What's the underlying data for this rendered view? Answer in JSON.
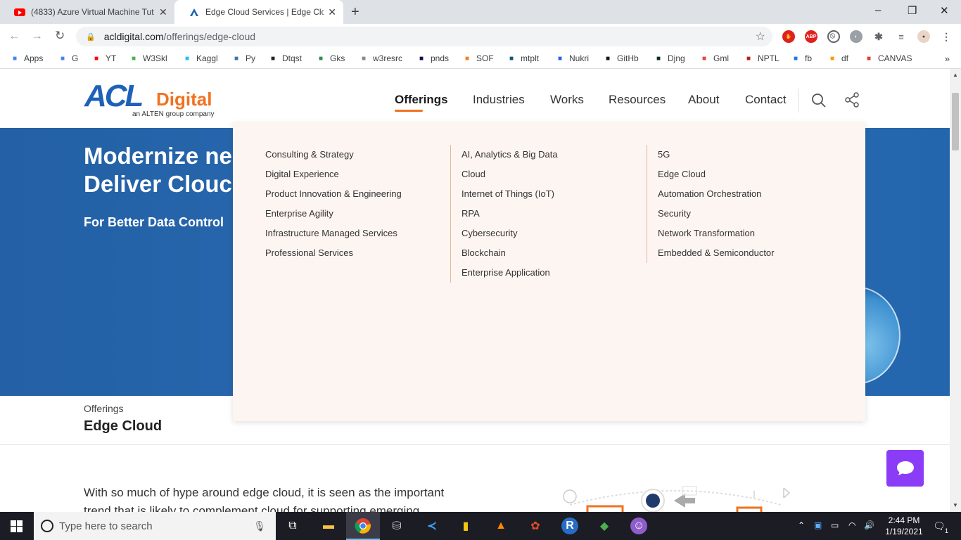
{
  "browser": {
    "tabs": [
      {
        "title": "(4833) Azure Virtual Machine Tut",
        "active": false,
        "favicon": "youtube-icon"
      },
      {
        "title": "Edge Cloud Services | Edge Clouc",
        "active": true,
        "favicon": "acl-digital-icon"
      }
    ],
    "new_tab_glyph": "+",
    "window_controls": [
      "–",
      "❐",
      "✕"
    ],
    "url_host": "acldigital.com",
    "url_path": "/offerings/edge-cloud",
    "bookmarks": [
      {
        "label": "Apps",
        "icon": "apps-grid-icon",
        "color": "#4285f4"
      },
      {
        "label": "G",
        "icon": "google-icon",
        "color": "#4285f4"
      },
      {
        "label": "YT",
        "icon": "youtube-icon",
        "color": "#ff0000"
      },
      {
        "label": "W3Skl",
        "icon": "w3schools-icon",
        "color": "#4caf50"
      },
      {
        "label": "Kaggl",
        "icon": "kaggle-icon",
        "color": "#20beff"
      },
      {
        "label": "Py",
        "icon": "python-icon",
        "color": "#3776ab"
      },
      {
        "label": "Dtqst",
        "icon": "dataquest-icon",
        "color": "#222222"
      },
      {
        "label": "Gks",
        "icon": "geeksforgeeks-icon",
        "color": "#2f8d46"
      },
      {
        "label": "w3resrc",
        "icon": "w3resource-icon",
        "color": "#888888"
      },
      {
        "label": "pnds",
        "icon": "pandas-icon",
        "color": "#150458"
      },
      {
        "label": "SOF",
        "icon": "stackoverflow-icon",
        "color": "#f48024"
      },
      {
        "label": "mtplt",
        "icon": "matplotlib-icon",
        "color": "#11557c"
      },
      {
        "label": "Nukri",
        "icon": "naukri-icon",
        "color": "#275df5"
      },
      {
        "label": "GitHb",
        "icon": "github-icon",
        "color": "#181717"
      },
      {
        "label": "Djng",
        "icon": "django-icon",
        "color": "#092e20"
      },
      {
        "label": "Gml",
        "icon": "gmail-icon",
        "color": "#ea4335"
      },
      {
        "label": "NPTL",
        "icon": "nptel-icon",
        "color": "#b22222"
      },
      {
        "label": "fb",
        "icon": "facebook-icon",
        "color": "#1877f2"
      },
      {
        "label": "df",
        "icon": "dialogflow-icon",
        "color": "#ff9800"
      },
      {
        "label": "CANVAS",
        "icon": "canvas-icon",
        "color": "#e13f2b"
      }
    ],
    "bookmarks_more": "»"
  },
  "site": {
    "logo_main": "ACL",
    "logo_sub": "Digital",
    "logo_tagline": "an ALTEN group company",
    "nav": [
      "Offerings",
      "Industries",
      "Works",
      "Resources",
      "About",
      "Contact"
    ],
    "active_nav": "Offerings",
    "accent_color": "#f0721f"
  },
  "hero": {
    "line1": "Modernize ne",
    "line2": "Deliver Clouc",
    "subtitle": "For Better Data Control"
  },
  "breadcrumb": {
    "parent": "Offerings",
    "current": "Edge Cloud"
  },
  "intro": {
    "line1": "With so much of hype around edge cloud, it is seen as the important",
    "line2": "trend that is likely to complement cloud for supporting emerging"
  },
  "mega_menu": {
    "col1": [
      "Consulting & Strategy",
      "Digital Experience",
      "Product Innovation & Engineering",
      "Enterprise Agility",
      "Infrastructure Managed Services",
      "Professional Services"
    ],
    "col2": [
      "AI, Analytics & Big Data",
      "Cloud",
      "Internet of Things (IoT)",
      "RPA",
      "Cybersecurity",
      "Blockchain",
      "Enterprise Application"
    ],
    "col3": [
      "5G",
      "Edge Cloud",
      "Automation Orchestration",
      "Security",
      "Network Transformation",
      "Embedded & Semiconductor"
    ]
  },
  "taskbar": {
    "search_placeholder": "Type here to search",
    "time": "2:44 PM",
    "date": "1/19/2021",
    "notification_count": "1"
  }
}
